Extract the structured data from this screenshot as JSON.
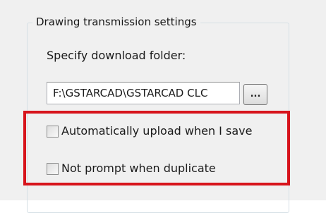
{
  "group": {
    "title": "Drawing transmission settings"
  },
  "download": {
    "label": "Specify download folder:",
    "path_value": "F:\\GSTARCAD\\GSTARCAD CLC",
    "browse_label": "..."
  },
  "options": [
    {
      "label": "Automatically upload when I save",
      "checked": false
    },
    {
      "label": "Not prompt when duplicate",
      "checked": false
    }
  ],
  "colors": {
    "highlight": "#d7141c",
    "panel_background": "#f0f0f0"
  }
}
